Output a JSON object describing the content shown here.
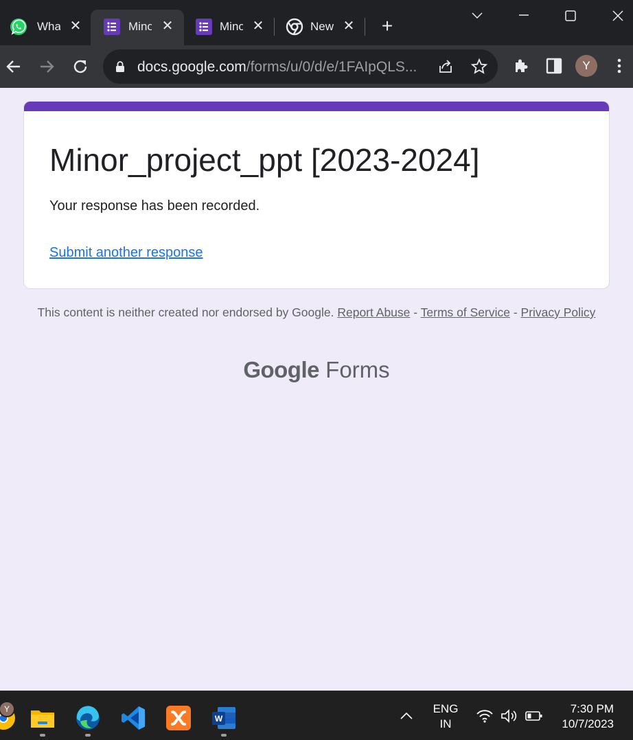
{
  "browser": {
    "tabs": [
      {
        "title": "WhatsApp",
        "icon": "whatsapp-icon",
        "active": false
      },
      {
        "title": "Minor_project_ppt",
        "icon": "google-forms-icon",
        "active": true
      },
      {
        "title": "Minor_project_ppt",
        "icon": "google-forms-icon",
        "active": false
      },
      {
        "title": "New Tab",
        "icon": "chrome-icon",
        "active": false
      }
    ],
    "url_host": "docs.google.com",
    "url_path": "/forms/u/0/d/e/1FAIpQLS...",
    "profile_initial": "Y"
  },
  "form": {
    "title": "Minor_project_ppt [2023-2024]",
    "confirmation": "Your response has been recorded.",
    "submit_another": "Submit another response",
    "accent_color": "#673ab7"
  },
  "footer": {
    "disclaimer": "This content is neither created nor endorsed by Google.",
    "report_abuse": "Report Abuse",
    "sep1": " - ",
    "terms": "Terms of Service",
    "sep2": " - ",
    "privacy": "Privacy Policy",
    "brand_google": "Google",
    "brand_forms": "Forms"
  },
  "taskbar": {
    "language_line1": "ENG",
    "language_line2": "IN",
    "time": "7:30 PM",
    "date": "10/7/2023",
    "user_initial": "Y",
    "apps": [
      "chrome-icon",
      "file-explorer-icon",
      "edge-icon",
      "vscode-icon",
      "xampp-icon",
      "word-icon"
    ]
  }
}
